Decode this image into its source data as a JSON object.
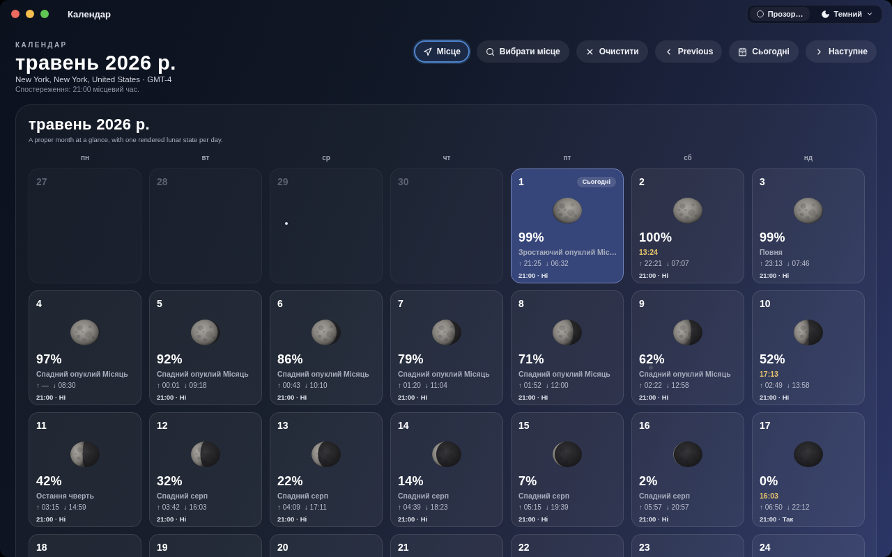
{
  "window": {
    "title": "Календар",
    "controls": [
      {
        "kind": "toggle",
        "label": "Прозор…",
        "on": false
      },
      {
        "kind": "dropdown",
        "label": "Темний"
      }
    ]
  },
  "header": {
    "eyebrow": "КАЛЕНДАР",
    "title": "травень 2026 р.",
    "location": "New York, New York, United States · GMT-4",
    "observation": "Спостереження: 21:00 місцевий час."
  },
  "toolbar": [
    {
      "kind": "locate",
      "label": "Місце",
      "selected": true
    },
    {
      "kind": "search",
      "label": "Вибрати місце",
      "selected": false
    },
    {
      "kind": "clear",
      "label": "Очистити",
      "selected": false
    },
    {
      "kind": "previous",
      "label": "Previous",
      "selected": false
    },
    {
      "kind": "today",
      "label": "Сьогодні",
      "selected": false
    },
    {
      "kind": "next",
      "label": "Наступне",
      "selected": false
    }
  ],
  "calendar": {
    "title": "травень 2026 р.",
    "subtitle": "A proper month at a glance, with one rendered lunar state per day.",
    "weekdays": [
      "пн",
      "вт",
      "ср",
      "чт",
      "пт",
      "сб",
      "нд"
    ],
    "days": [
      {
        "day": "27",
        "in_month": false,
        "today": false
      },
      {
        "day": "28",
        "in_month": false,
        "today": false
      },
      {
        "day": "29",
        "in_month": false,
        "today": false
      },
      {
        "day": "30",
        "in_month": false,
        "today": false
      },
      {
        "day": "1",
        "in_month": true,
        "today": true,
        "badge": "Сьогодні",
        "waxing": true,
        "percent": "99%",
        "note": {
          "kind": "phase",
          "text": "Зростаючий опуклий Міс…"
        },
        "rise": "↑ 21:25",
        "set": "↓ 06:32",
        "status": "21:00 · Ні"
      },
      {
        "day": "2",
        "in_month": true,
        "today": false,
        "waxing": false,
        "percent": "100%",
        "note": {
          "kind": "event",
          "text": "13:24"
        },
        "rise": "↑ 22:21",
        "set": "↓ 07:07",
        "status": "21:00 · Ні"
      },
      {
        "day": "3",
        "in_month": true,
        "today": false,
        "waxing": false,
        "percent": "99%",
        "note": {
          "kind": "phase",
          "text": "Повня"
        },
        "rise": "↑ 23:13",
        "set": "↓ 07:46",
        "status": "21:00 · Ні"
      },
      {
        "day": "4",
        "in_month": true,
        "today": false,
        "waxing": false,
        "percent": "97%",
        "note": {
          "kind": "phase",
          "text": "Спадний опуклий Місяць"
        },
        "rise": "↑ —",
        "set": "↓ 08:30",
        "status": "21:00 · Ні"
      },
      {
        "day": "5",
        "in_month": true,
        "today": false,
        "waxing": false,
        "percent": "92%",
        "note": {
          "kind": "phase",
          "text": "Спадний опуклий Місяць"
        },
        "rise": "↑ 00:01",
        "set": "↓ 09:18",
        "status": "21:00 · Ні"
      },
      {
        "day": "6",
        "in_month": true,
        "today": false,
        "waxing": false,
        "percent": "86%",
        "note": {
          "kind": "phase",
          "text": "Спадний опуклий Місяць"
        },
        "rise": "↑ 00:43",
        "set": "↓ 10:10",
        "status": "21:00 · Ні"
      },
      {
        "day": "7",
        "in_month": true,
        "today": false,
        "waxing": false,
        "percent": "79%",
        "note": {
          "kind": "phase",
          "text": "Спадний опуклий Місяць"
        },
        "rise": "↑ 01:20",
        "set": "↓ 11:04",
        "status": "21:00 · Ні"
      },
      {
        "day": "8",
        "in_month": true,
        "today": false,
        "waxing": false,
        "percent": "71%",
        "note": {
          "kind": "phase",
          "text": "Спадний опуклий Місяць"
        },
        "rise": "↑ 01:52",
        "set": "↓ 12:00",
        "status": "21:00 · Ні"
      },
      {
        "day": "9",
        "in_month": true,
        "today": false,
        "waxing": false,
        "percent": "62%",
        "note": {
          "kind": "phase",
          "text": "Спадний опуклий Місяць"
        },
        "rise": "↑ 02:22",
        "set": "↓ 12:58",
        "status": "21:00 · Ні"
      },
      {
        "day": "10",
        "in_month": true,
        "today": false,
        "waxing": false,
        "percent": "52%",
        "note": {
          "kind": "event",
          "text": "17:13"
        },
        "rise": "↑ 02:49",
        "set": "↓ 13:58",
        "status": "21:00 · Ні"
      },
      {
        "day": "11",
        "in_month": true,
        "today": false,
        "waxing": false,
        "percent": "42%",
        "note": {
          "kind": "phase",
          "text": "Остання чверть"
        },
        "rise": "↑ 03:15",
        "set": "↓ 14:59",
        "status": "21:00 · Ні"
      },
      {
        "day": "12",
        "in_month": true,
        "today": false,
        "waxing": false,
        "percent": "32%",
        "note": {
          "kind": "phase",
          "text": "Спадний серп"
        },
        "rise": "↑ 03:42",
        "set": "↓ 16:03",
        "status": "21:00 · Ні"
      },
      {
        "day": "13",
        "in_month": true,
        "today": false,
        "waxing": false,
        "percent": "22%",
        "note": {
          "kind": "phase",
          "text": "Спадний серп"
        },
        "rise": "↑ 04:09",
        "set": "↓ 17:11",
        "status": "21:00 · Ні"
      },
      {
        "day": "14",
        "in_month": true,
        "today": false,
        "waxing": false,
        "percent": "14%",
        "note": {
          "kind": "phase",
          "text": "Спадний серп"
        },
        "rise": "↑ 04:39",
        "set": "↓ 18:23",
        "status": "21:00 · Ні"
      },
      {
        "day": "15",
        "in_month": true,
        "today": false,
        "waxing": false,
        "percent": "7%",
        "note": {
          "kind": "phase",
          "text": "Спадний серп"
        },
        "rise": "↑ 05:15",
        "set": "↓ 19:39",
        "status": "21:00 · Ні"
      },
      {
        "day": "16",
        "in_month": true,
        "today": false,
        "waxing": false,
        "percent": "2%",
        "note": {
          "kind": "phase",
          "text": "Спадний серп"
        },
        "rise": "↑ 05:57",
        "set": "↓ 20:57",
        "status": "21:00 · Ні"
      },
      {
        "day": "17",
        "in_month": true,
        "today": false,
        "waxing": false,
        "percent": "0%",
        "note": {
          "kind": "event",
          "text": "16:03"
        },
        "rise": "↑ 06:50",
        "set": "↓ 22:12",
        "status": "21:00 · Так"
      },
      {
        "day": "18",
        "in_month": true,
        "today": false
      },
      {
        "day": "19",
        "in_month": true,
        "today": false
      },
      {
        "day": "20",
        "in_month": true,
        "today": false
      },
      {
        "day": "21",
        "in_month": true,
        "today": false
      },
      {
        "day": "22",
        "in_month": true,
        "today": false
      },
      {
        "day": "23",
        "in_month": true,
        "today": false
      },
      {
        "day": "24",
        "in_month": true,
        "today": false
      }
    ]
  }
}
